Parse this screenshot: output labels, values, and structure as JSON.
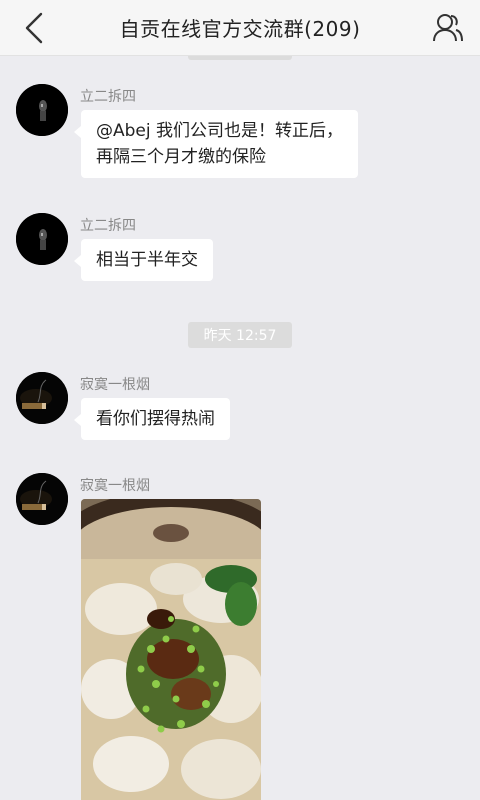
{
  "header": {
    "title": "自贡在线官方交流群(209)",
    "back_icon": "chevron-left-icon",
    "members_icon": "users-icon"
  },
  "messages": [
    {
      "sender": "立二拆四",
      "lines": [
        "@Abej 我们公司也是！转正后，",
        "再隔三个月才缴的保险"
      ]
    },
    {
      "sender": "立二拆四",
      "lines": [
        "相当于半年交"
      ]
    },
    {
      "sender": "寂寞一根烟",
      "lines": [
        "看你们摆得热闹"
      ]
    },
    {
      "sender": "寂寞一根烟",
      "image": "photo-wonton-soup"
    }
  ],
  "timestamp": "昨天 12:57",
  "colors": {
    "background": "#ececf0",
    "header_bg": "#f6f6f6",
    "bubble_bg": "#ffffff",
    "timestamp_bg": "#dcdcdc"
  }
}
